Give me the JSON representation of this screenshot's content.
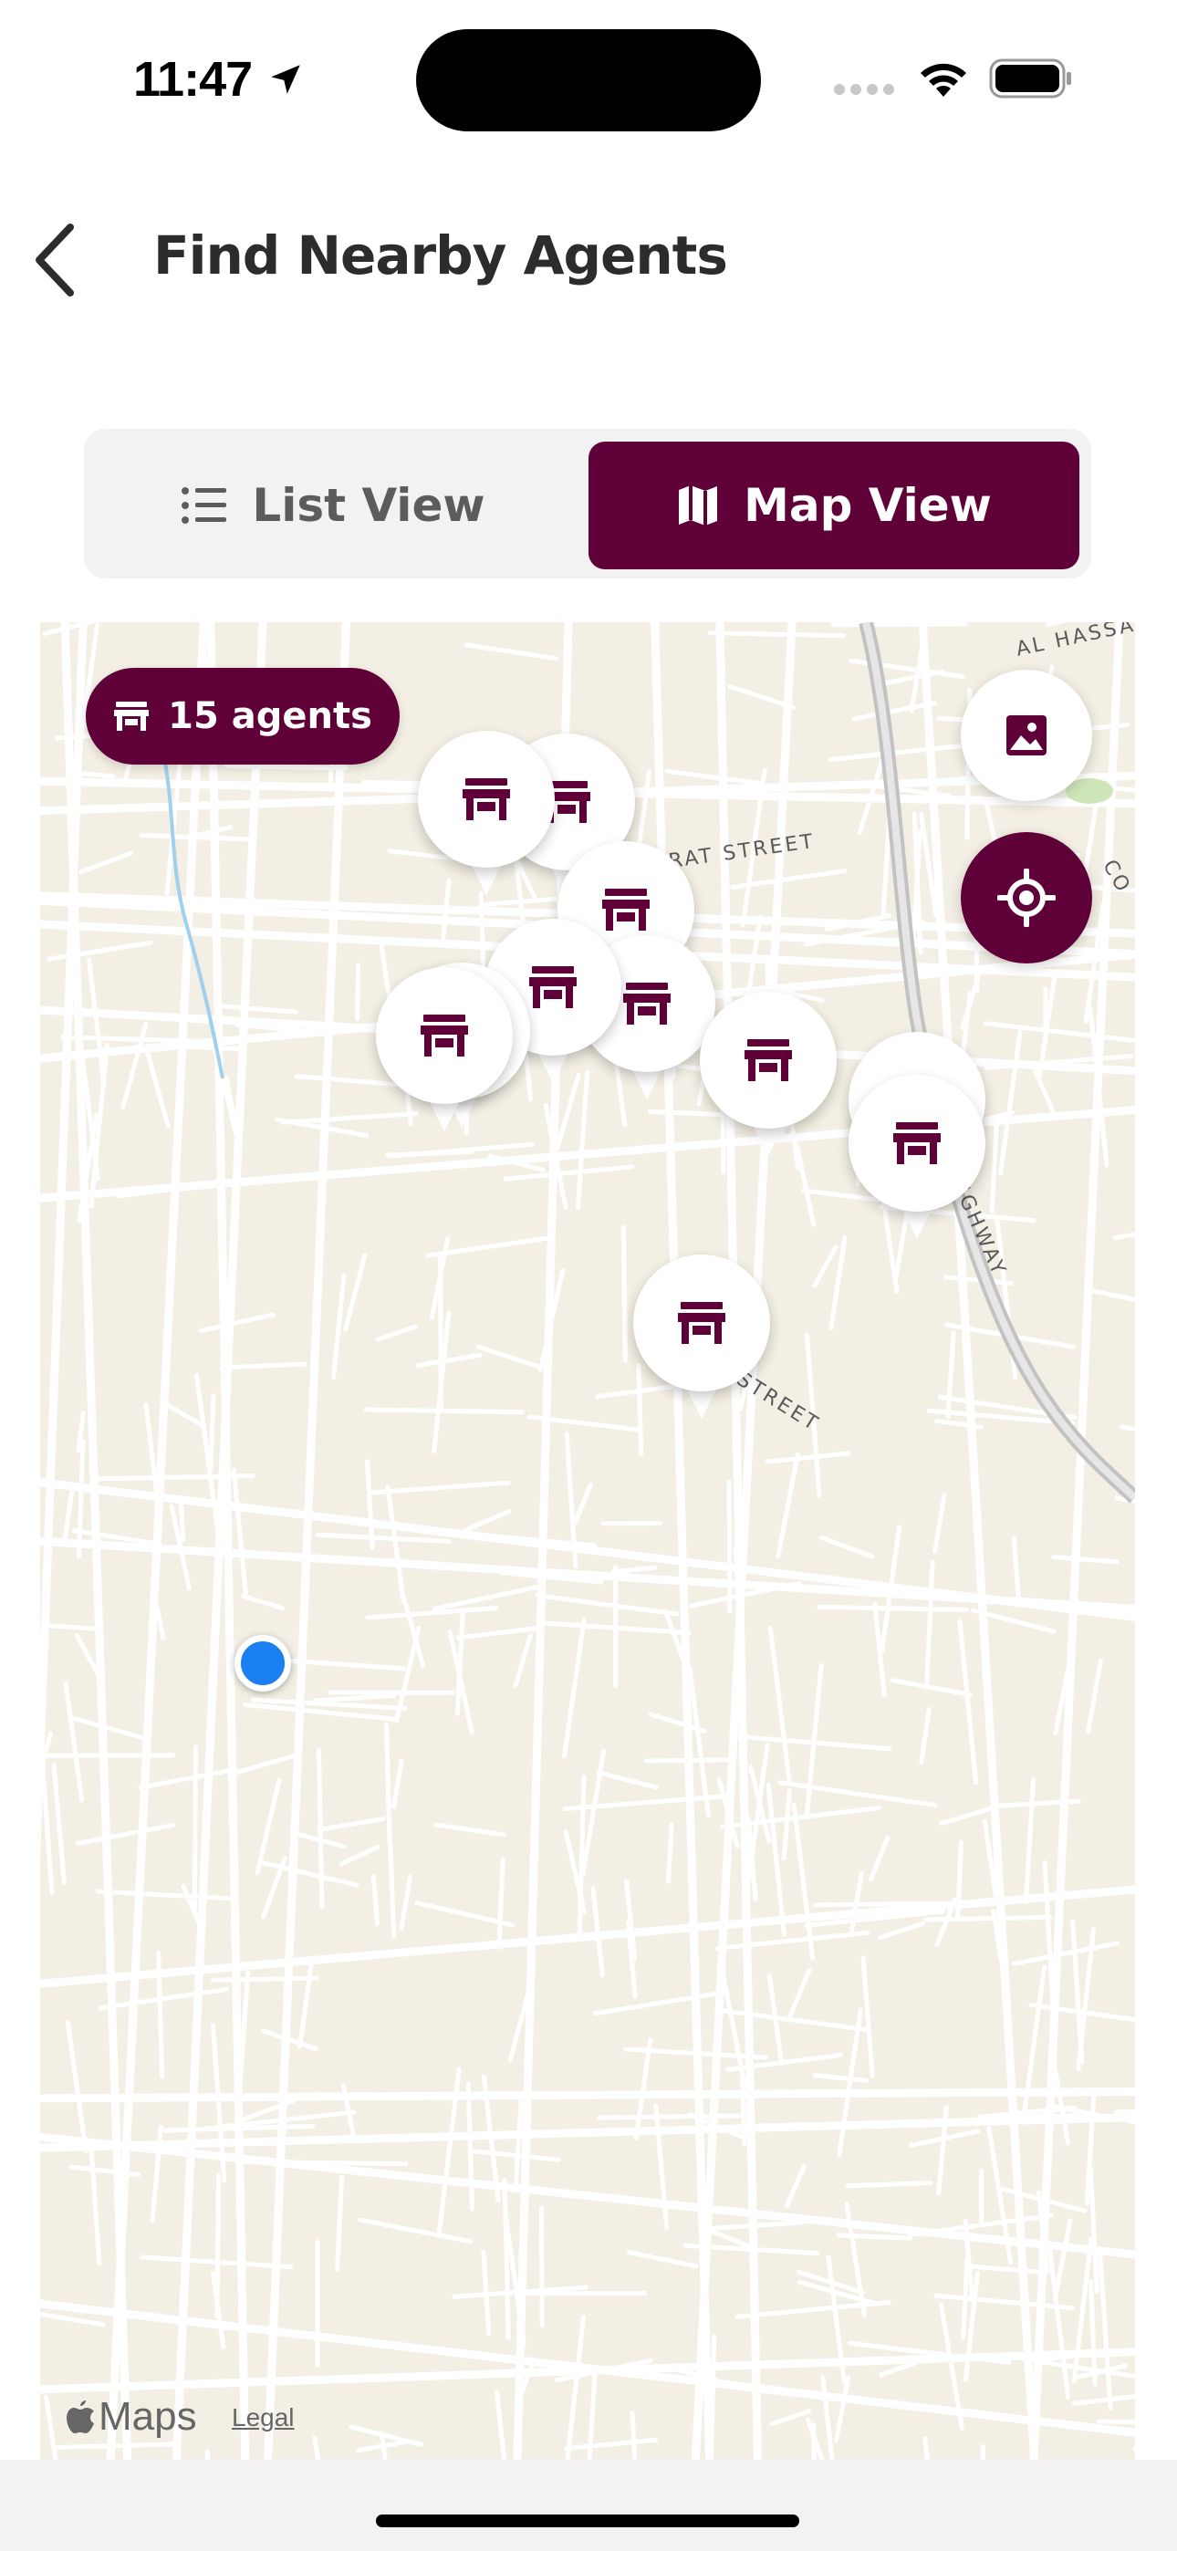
{
  "status_bar": {
    "time": "11:47"
  },
  "header": {
    "title": "Find Nearby Agents"
  },
  "view_toggle": {
    "list_label": "List View",
    "map_label": "Map View",
    "selected": "Map View"
  },
  "map": {
    "agent_count_label": "15 agents",
    "street_labels": [
      "AL HASSA",
      "NUSRAT STREET",
      "BRIKAMA HIGHWAY",
      "KAABU STREET",
      "CO"
    ],
    "attribution": "Maps",
    "legal": "Legal"
  },
  "colors": {
    "brand": "#5f0038",
    "user_location": "#1a7ff0",
    "map_bg": "#f3efe4"
  },
  "icons": [
    "back-chevron-icon",
    "list-icon",
    "map-icon",
    "store-icon",
    "image-icon",
    "locate-icon",
    "apple-icon"
  ]
}
